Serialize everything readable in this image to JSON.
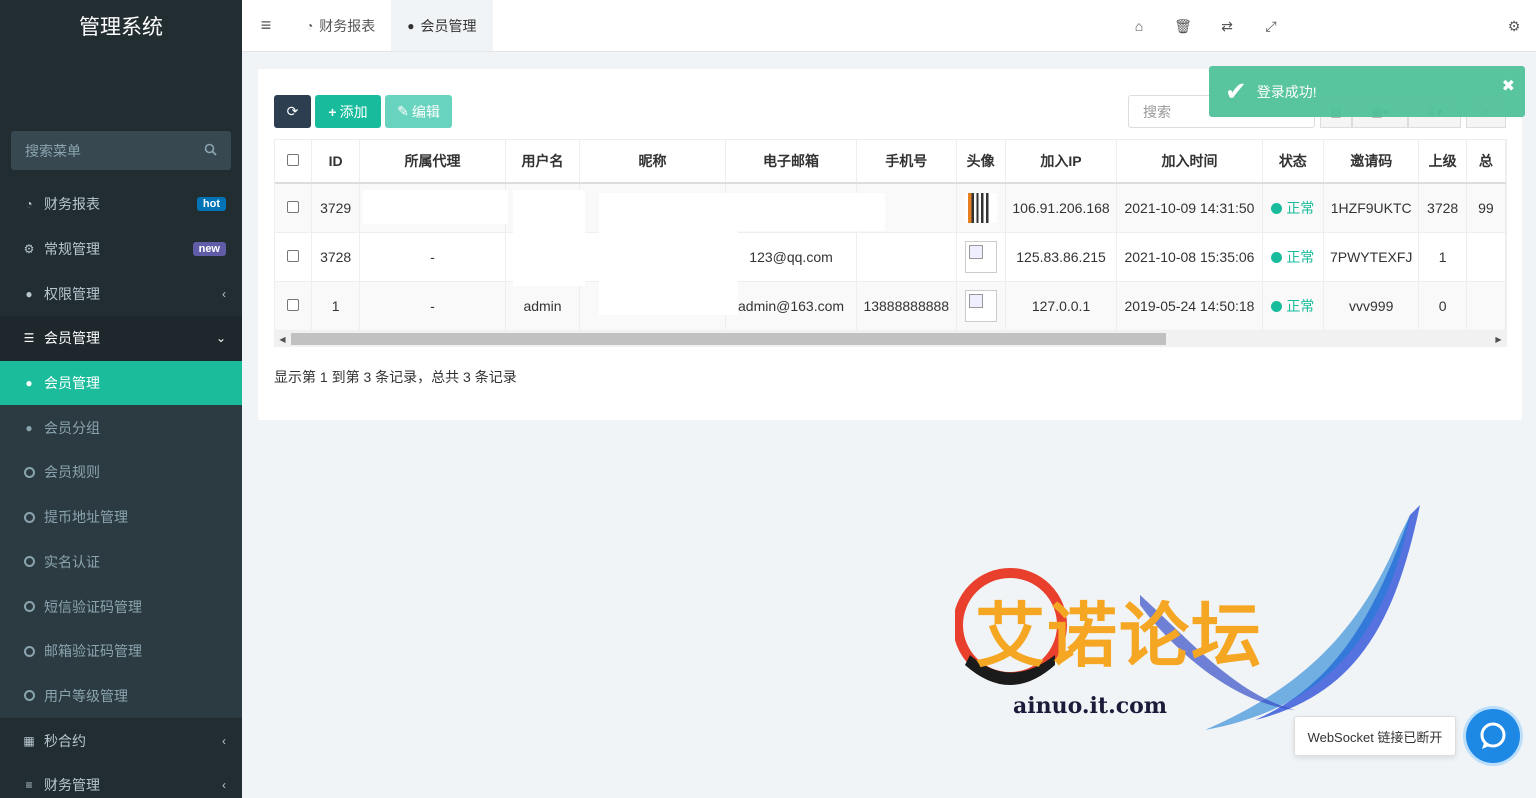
{
  "sidebar": {
    "brand": "管理系统",
    "search_placeholder": "搜索菜单",
    "items": [
      {
        "label": "财务报表",
        "icon": "dashboard-icon",
        "badge": "hot"
      },
      {
        "label": "常规管理",
        "icon": "cogs-icon",
        "badge": "new"
      },
      {
        "label": "权限管理",
        "icon": "users-icon"
      },
      {
        "label": "会员管理",
        "icon": "list-icon"
      },
      {
        "label": "会员管理",
        "icon": "user-icon"
      },
      {
        "label": "会员分组",
        "icon": "users-icon"
      },
      {
        "label": "会员规则",
        "icon": "circle-icon"
      },
      {
        "label": "提币地址管理",
        "icon": "circle-icon"
      },
      {
        "label": "实名认证",
        "icon": "circle-icon"
      },
      {
        "label": "短信验证码管理",
        "icon": "circle-icon"
      },
      {
        "label": "邮箱验证码管理",
        "icon": "circle-icon"
      },
      {
        "label": "用户等级管理",
        "icon": "circle-icon"
      },
      {
        "label": "秒合约",
        "icon": "calendar-icon"
      },
      {
        "label": "财务管理",
        "icon": "database-icon"
      }
    ]
  },
  "topbar": {
    "tabs": [
      {
        "label": "财务报表",
        "icon": "dashboard-icon"
      },
      {
        "label": "会员管理",
        "icon": "user-icon"
      }
    ]
  },
  "toolbar": {
    "add_label": "添加",
    "edit_label": "编辑",
    "search_placeholder": "搜索"
  },
  "table": {
    "columns": [
      "ID",
      "所属代理",
      "用户名",
      "昵称",
      "电子邮箱",
      "手机号",
      "头像",
      "加入IP",
      "加入时间",
      "状态",
      "邀请码",
      "上级",
      "总"
    ],
    "rows": [
      {
        "id": "3729",
        "agent": "",
        "username": "",
        "nickname": "",
        "email": "",
        "mobile": "",
        "ip": "106.91.206.168",
        "jointime": "2021-10-09 14:31:50",
        "status": "正常",
        "invite": "1HZF9UKTC",
        "parent": "3728",
        "total": "99"
      },
      {
        "id": "3728",
        "agent": "-",
        "username": "",
        "nickname": "",
        "email": "123@qq.com",
        "mobile": "",
        "ip": "125.83.86.215",
        "jointime": "2021-10-08 15:35:06",
        "status": "正常",
        "invite": "7PWYTEXFJ",
        "parent": "1",
        "total": ""
      },
      {
        "id": "1",
        "agent": "-",
        "username": "admin",
        "nickname": "",
        "email": "admin@163.com",
        "mobile": "13888888888",
        "ip": "127.0.0.1",
        "jointime": "2019-05-24 14:50:18",
        "status": "正常",
        "invite": "vvv999",
        "parent": "0",
        "total": ""
      }
    ]
  },
  "pagination": {
    "info": "显示第 1 到第 3 条记录，总共 3 条记录"
  },
  "toast": {
    "message": "登录成功!"
  },
  "watermark": {
    "text": "艾诺论坛",
    "url": "ainuo.it.com"
  },
  "websocket": {
    "status": "WebSocket 链接已断开"
  }
}
